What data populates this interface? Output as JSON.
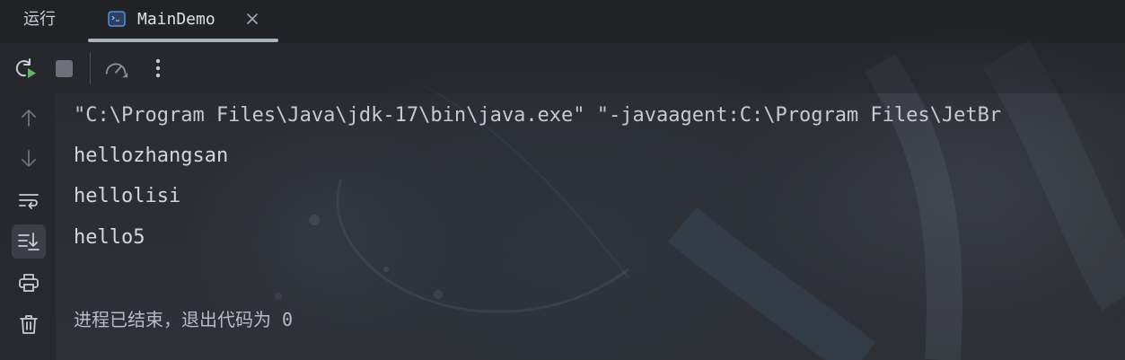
{
  "tabs": {
    "run_label": "运行",
    "file_tab": {
      "label": "MainDemo",
      "icon": "terminal-window-icon"
    }
  },
  "toolbar": {
    "items": [
      {
        "icon": "rerun-icon"
      },
      {
        "icon": "stop-icon"
      },
      {
        "icon": "profiler-gauge-icon"
      },
      {
        "icon": "more-vertical-icon"
      }
    ]
  },
  "gutter": {
    "items": [
      {
        "icon": "arrow-up-icon"
      },
      {
        "icon": "arrow-down-icon"
      },
      {
        "icon": "soft-wrap-icon"
      },
      {
        "icon": "scroll-to-end-icon",
        "active": true
      },
      {
        "icon": "print-icon"
      },
      {
        "icon": "trash-icon"
      }
    ]
  },
  "console": {
    "lines": [
      "\"C:\\Program Files\\Java\\jdk-17\\bin\\java.exe\" \"-javaagent:C:\\Program Files\\JetBr",
      "hellozhangsan",
      "hellolisi",
      "hello5"
    ],
    "exit_message": "进程已结束，退出代码为 0"
  },
  "colors": {
    "background": "#2b2d33",
    "text": "#d4d6db",
    "accent_run": "#5fb865",
    "tab_icon": "#5a8fd6"
  }
}
